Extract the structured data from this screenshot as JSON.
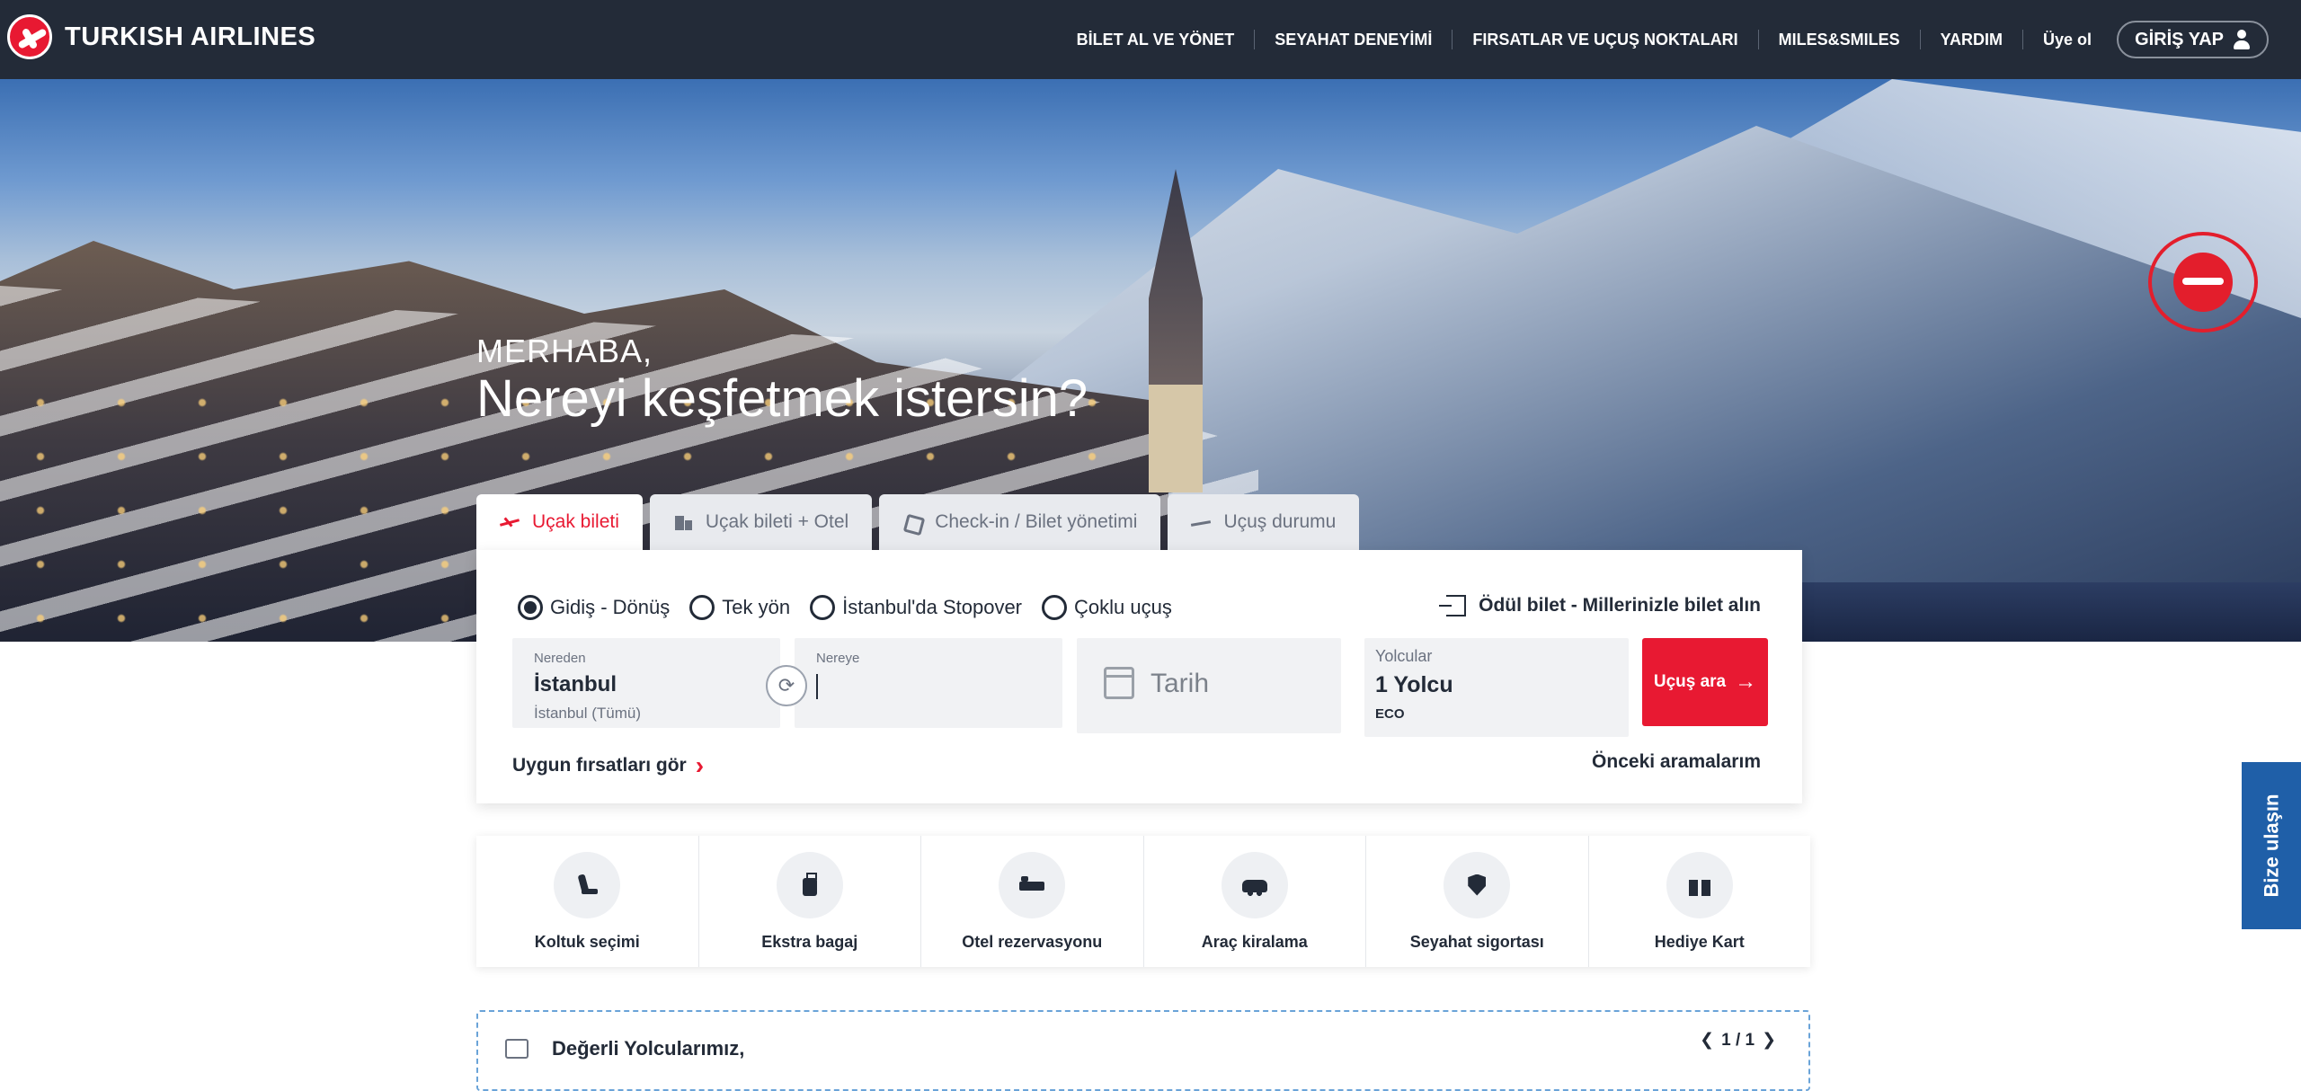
{
  "header": {
    "logo_text": "TURKISH AIRLINES",
    "nav": [
      "BİLET AL VE YÖNET",
      "SEYAHAT DENEYİMİ",
      "FIRSATLAR VE UÇUŞ NOKTALARI",
      "MILES&SMILES",
      "YARDIM",
      "Üye ol"
    ],
    "login_label": "GİRİŞ YAP"
  },
  "hero": {
    "greeting": "MERHABA,",
    "headline": "Nereyi keşfetmek istersin?"
  },
  "tabs": [
    {
      "label": "Uçak bileti",
      "icon": "plane-icon",
      "active": true
    },
    {
      "label": "Uçak bileti + Otel",
      "icon": "hotel-icon",
      "active": false
    },
    {
      "label": "Check-in / Bilet yönetimi",
      "icon": "checkin-icon",
      "active": false
    },
    {
      "label": "Uçuş durumu",
      "icon": "flight-status-icon",
      "active": false
    }
  ],
  "booking": {
    "trip_types": [
      {
        "label": "Gidiş - Dönüş",
        "checked": true
      },
      {
        "label": "Tek yön",
        "checked": false
      },
      {
        "label": "İstanbul'da Stopover",
        "checked": false
      },
      {
        "label": "Çoklu uçuş",
        "checked": false
      }
    ],
    "award_label": "Ödül bilet - Millerinizle bilet alın",
    "from": {
      "label": "Nereden",
      "value": "İstanbul",
      "sub": "İstanbul (Tümü)"
    },
    "to": {
      "label": "Nereye",
      "value": ""
    },
    "date": {
      "placeholder": "Tarih"
    },
    "passengers": {
      "label": "Yolcular",
      "value": "1 Yolcu",
      "cabin": "ECO"
    },
    "search_label": "Uçuş ara",
    "deals_label": "Uygun fırsatları gör",
    "previous_label": "Önceki aramalarım"
  },
  "services": [
    {
      "label": "Koltuk seçimi",
      "icon": "seat-icon"
    },
    {
      "label": "Ekstra bagaj",
      "icon": "baggage-icon"
    },
    {
      "label": "Otel rezervasyonu",
      "icon": "hotel-bed-icon"
    },
    {
      "label": "Araç kiralama",
      "icon": "car-icon"
    },
    {
      "label": "Seyahat sigortası",
      "icon": "insurance-shield-icon"
    },
    {
      "label": "Hediye Kart",
      "icon": "gift-icon"
    }
  ],
  "notice": {
    "title": "Değerli Yolcularımız,",
    "pager": "1 / 1"
  },
  "contact_tab": "Bize ulaşın",
  "colors": {
    "brand_red": "#e81932",
    "nav_dark": "#232b38",
    "contact_blue": "#1f5fa8"
  }
}
